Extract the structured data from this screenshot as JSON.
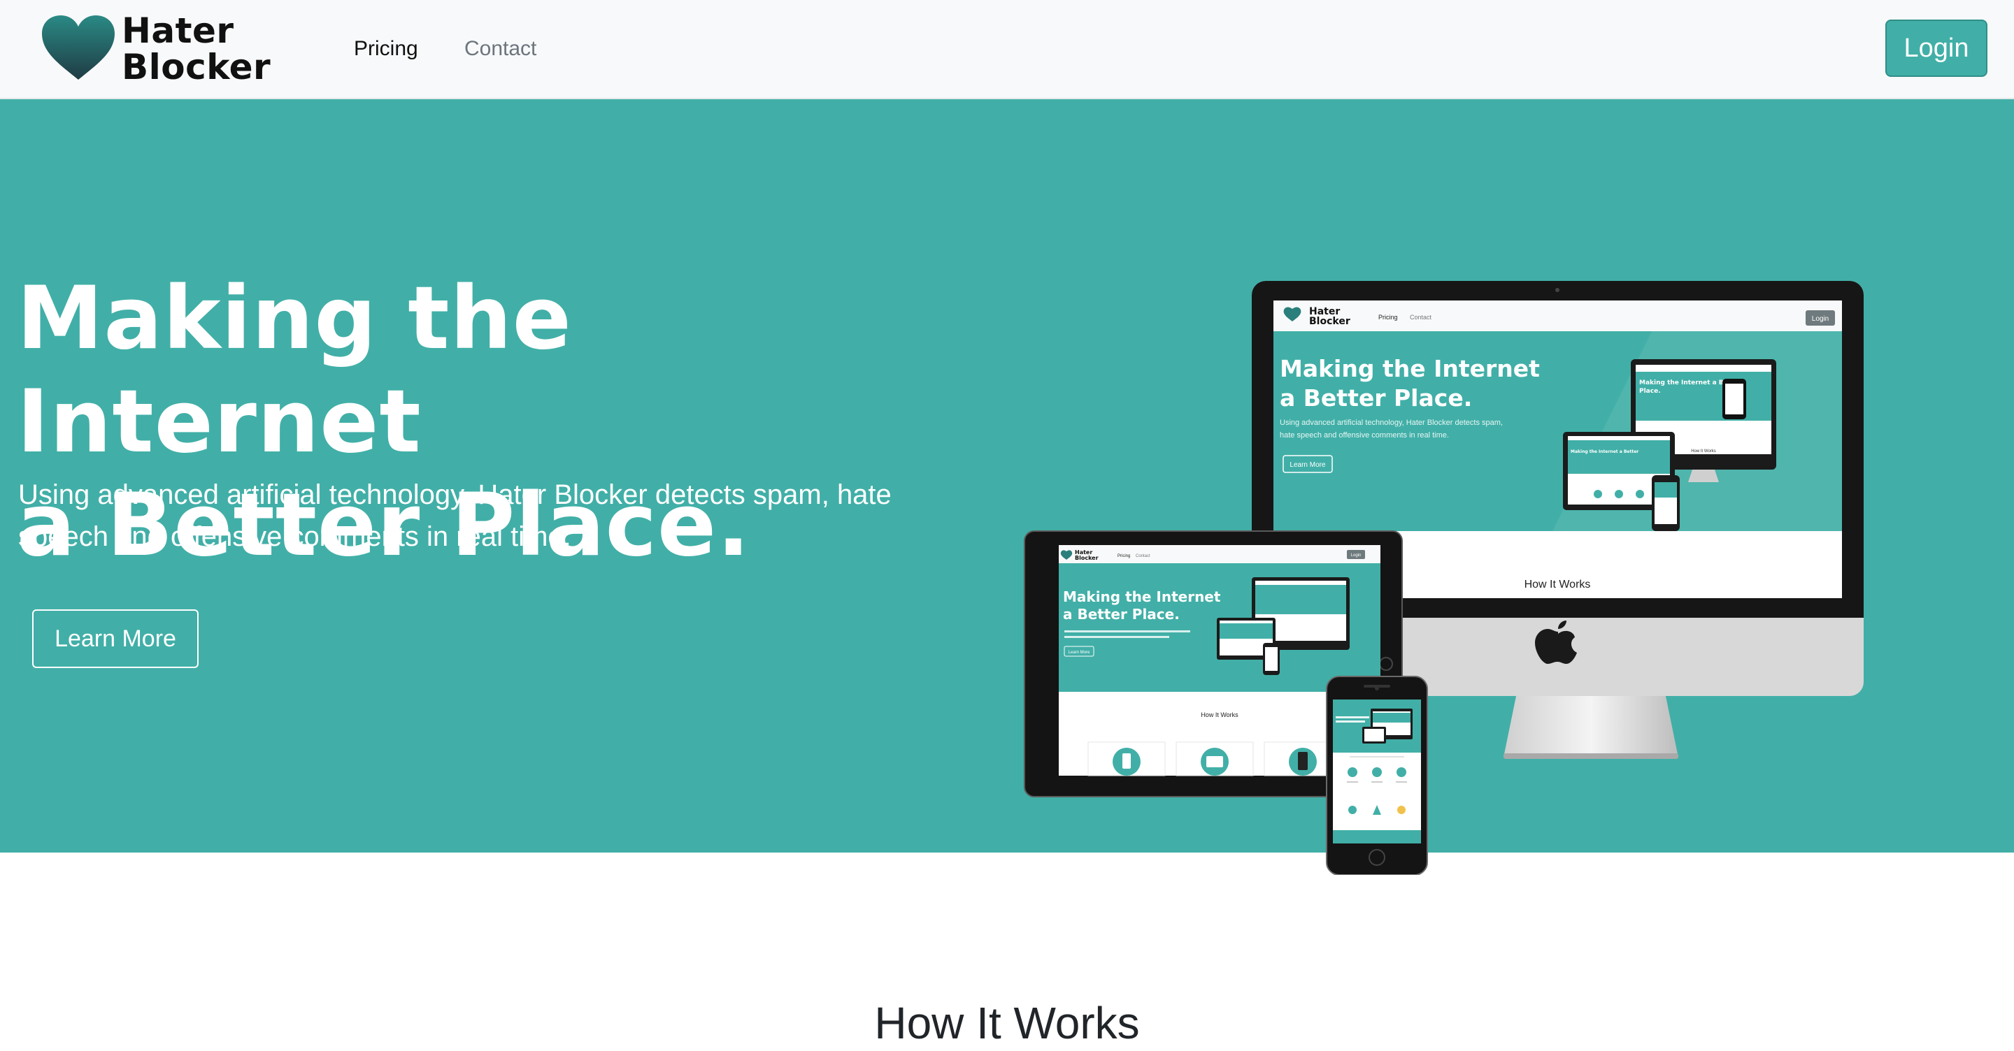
{
  "brand": {
    "name_line1": "Hater",
    "name_line2": "Blocker",
    "accent_color": "#41afa7",
    "logo_icon": "heart-icon"
  },
  "nav": {
    "links": [
      {
        "label": "Pricing"
      },
      {
        "label": "Contact"
      }
    ],
    "login_label": "Login"
  },
  "hero": {
    "title_line1": "Making the Internet",
    "title_line2": "a Better Place.",
    "subtitle": "Using advanced artificial technology, Hater Blocker detects spam, hate speech and offensive comments in real time.",
    "cta_label": "Learn More",
    "illustration": "responsive-devices-mockup"
  },
  "mockup": {
    "desktop": {
      "logo_line1": "Hater",
      "logo_line2": "Blocker",
      "nav1": "Pricing",
      "nav2": "Contact",
      "login": "Login",
      "title_line1": "Making the Internet",
      "title_line2": "a Better Place.",
      "sub_line1": "Using advanced artificial technology, Hater Blocker detects spam,",
      "sub_line2": "hate speech and offensive comments in real time.",
      "cta": "Learn More",
      "section": "How It Works"
    },
    "tablet": {
      "logo_line1": "Hater",
      "logo_line2": "Blocker",
      "nav1": "Pricing",
      "nav2": "Contact",
      "login": "Login",
      "title_line1": "Making the Internet",
      "title_line2": "a Better Place.",
      "cta": "Learn More",
      "section": "How It Works"
    }
  },
  "how_it_works": {
    "title": "How It Works"
  }
}
